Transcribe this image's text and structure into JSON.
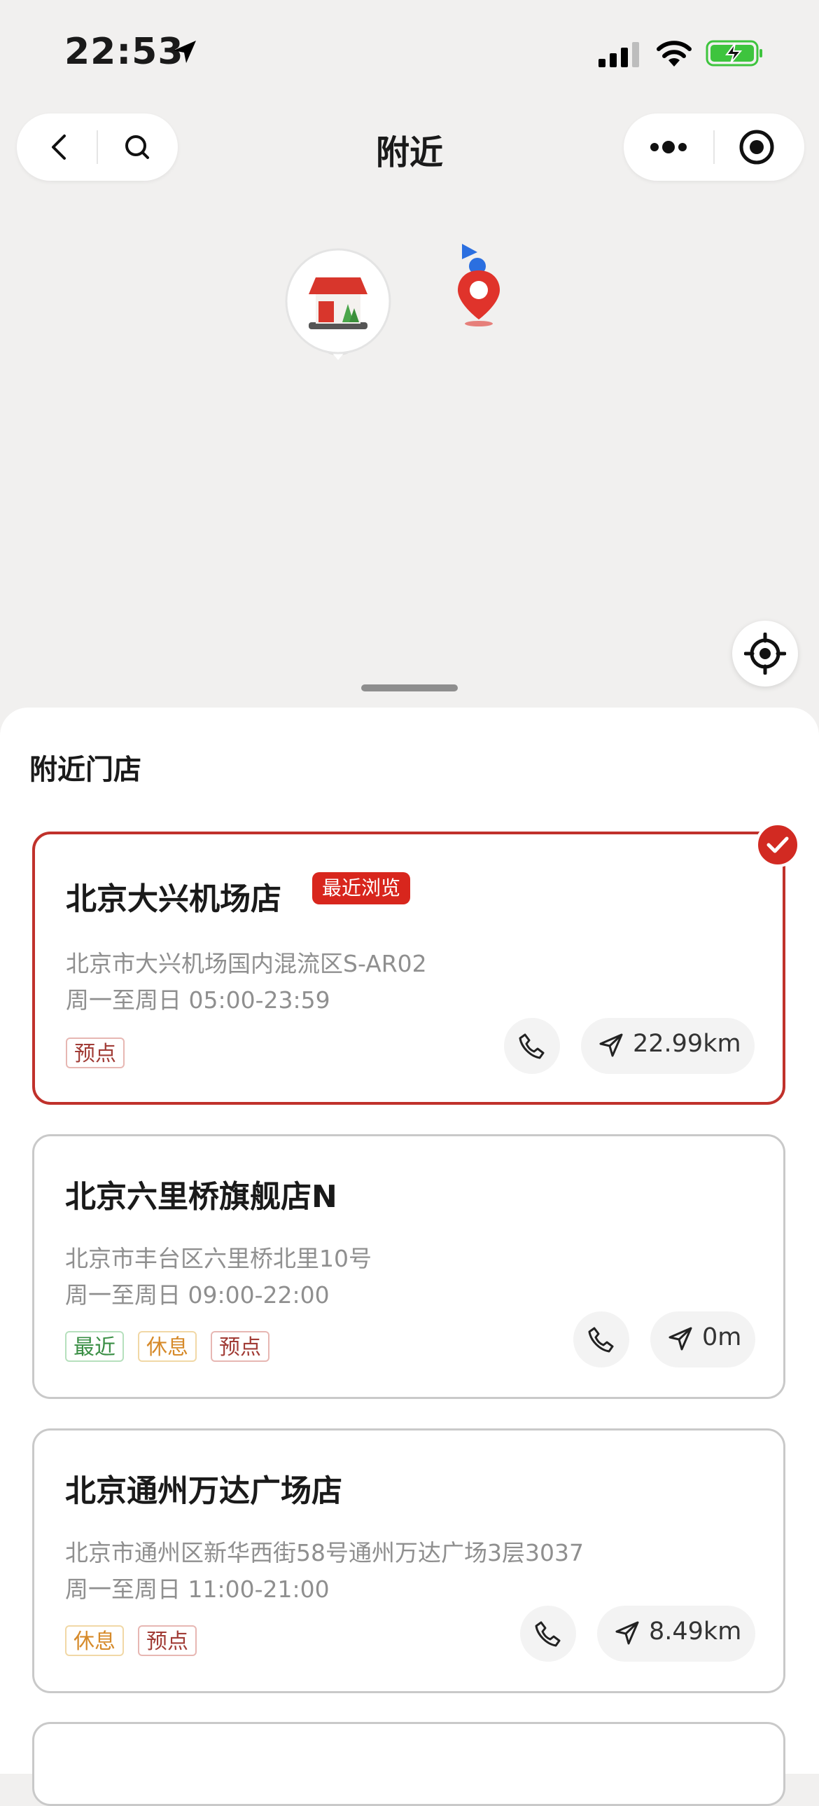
{
  "status_bar": {
    "time": "22:53",
    "icons": [
      "location-arrow-icon",
      "cellular-signal-icon",
      "wifi-icon",
      "battery-charging-icon"
    ]
  },
  "nav": {
    "title": "附近",
    "icons": [
      "back-icon",
      "search-icon",
      "more-icon",
      "capsule-close-icon"
    ]
  },
  "map": {
    "icons": [
      "store-marker-icon",
      "user-location-icon",
      "locate-me-icon"
    ]
  },
  "sheet": {
    "section_title": "附近门店",
    "stores": [
      {
        "name": "北京大兴机场店",
        "badge": "最近浏览",
        "address": "北京市大兴机场国内混流区S-AR02",
        "hours": "周一至周日 05:00-23:59",
        "tags": [
          "预点"
        ],
        "distance": "22.99km",
        "selected": true
      },
      {
        "name": "北京六里桥旗舰店N",
        "address": "北京市丰台区六里桥北里10号",
        "hours": "周一至周日 09:00-22:00",
        "tags": [
          "最近",
          "休息",
          "预点"
        ],
        "distance": "0m",
        "selected": false
      },
      {
        "name": "北京通州万达广场店",
        "address": "北京市通州区新华西街58号通州万达广场3层3037",
        "hours": "周一至周日 11:00-21:00",
        "tags": [
          "休息",
          "预点"
        ],
        "distance": "8.49km",
        "selected": false
      }
    ]
  },
  "colors": {
    "brand_red": "#d8261d",
    "selected_border": "#c0312b",
    "tag_green": "#3a8e45",
    "tag_orange": "#d68a2a",
    "tag_red": "#a13c36"
  }
}
